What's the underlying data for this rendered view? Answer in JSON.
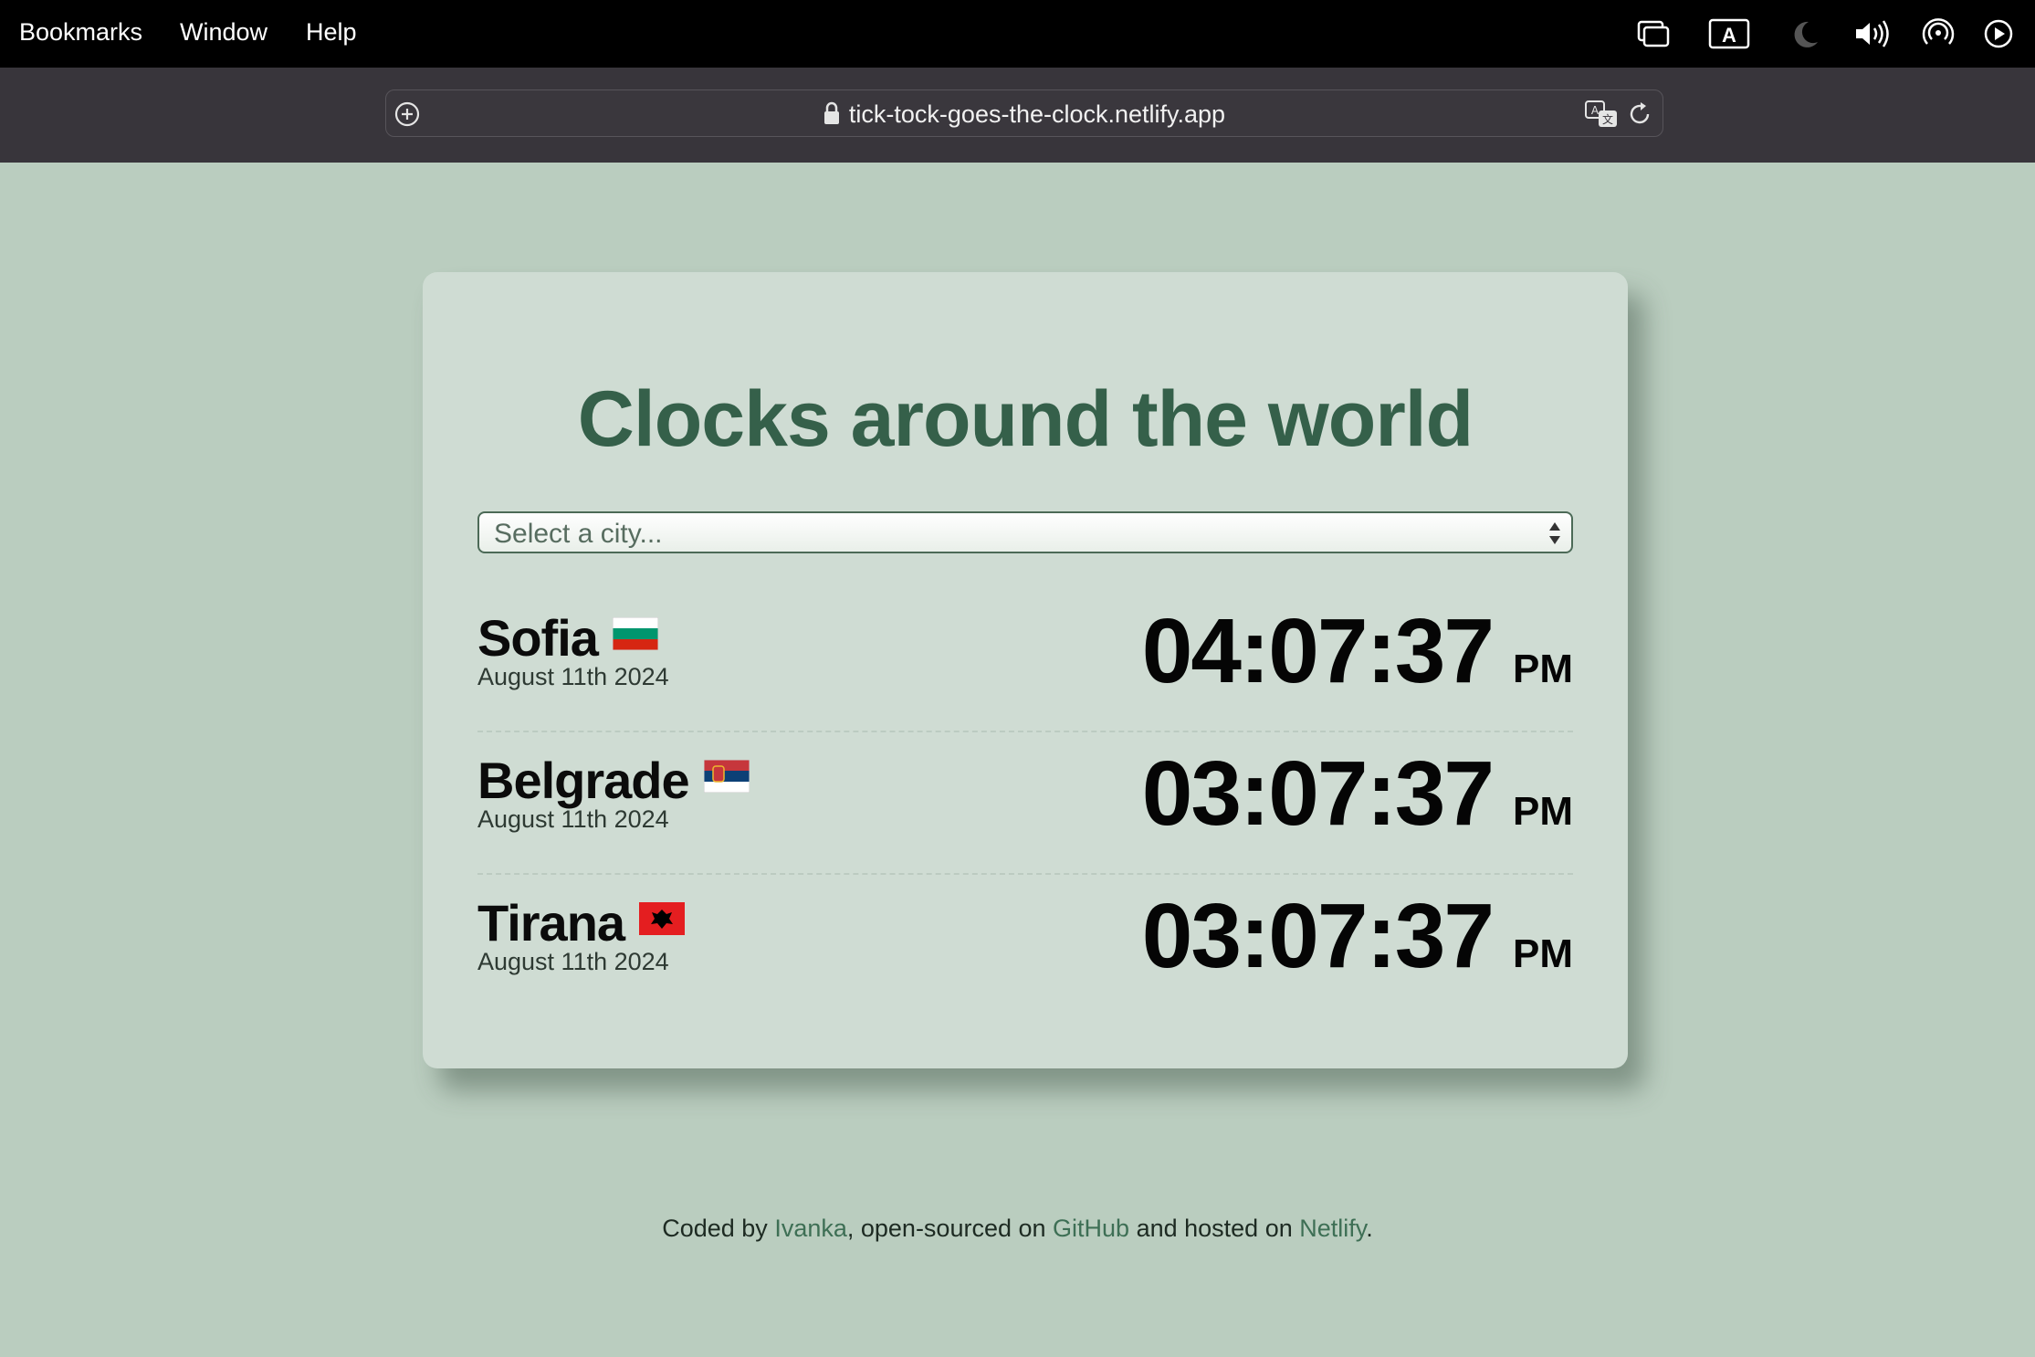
{
  "menubar": {
    "items": [
      "Bookmarks",
      "Window",
      "Help"
    ],
    "tray_icons": [
      "screen-mirror-icon",
      "keyboard-input-a-icon",
      "moon-icon",
      "volume-icon",
      "airdrop-icon",
      "play-circle-icon"
    ]
  },
  "browser": {
    "url": "tick-tock-goes-the-clock.netlify.app"
  },
  "app": {
    "title": "Clocks around the world",
    "select_placeholder": "Select a city...",
    "cities": [
      {
        "name": "Sofia",
        "flag": "bulgaria-flag",
        "date": "August 11th 2024",
        "time": "04:07:37",
        "ampm": "PM"
      },
      {
        "name": "Belgrade",
        "flag": "serbia-flag",
        "date": "August 11th 2024",
        "time": "03:07:37",
        "ampm": "PM"
      },
      {
        "name": "Tirana",
        "flag": "albania-flag",
        "date": "August 11th 2024",
        "time": "03:07:37",
        "ampm": "PM"
      }
    ]
  },
  "footer": {
    "prefix": "Coded by ",
    "author": "Ivanka",
    "mid1": ", open-sourced on ",
    "github": "GitHub",
    "mid2": " and hosted on ",
    "netlify": "Netlify",
    "suffix": "."
  },
  "colors": {
    "page_background": "#bacdbf",
    "card_background": "#cfdcd3",
    "title": "#35604a",
    "link": "#3e6f55"
  }
}
